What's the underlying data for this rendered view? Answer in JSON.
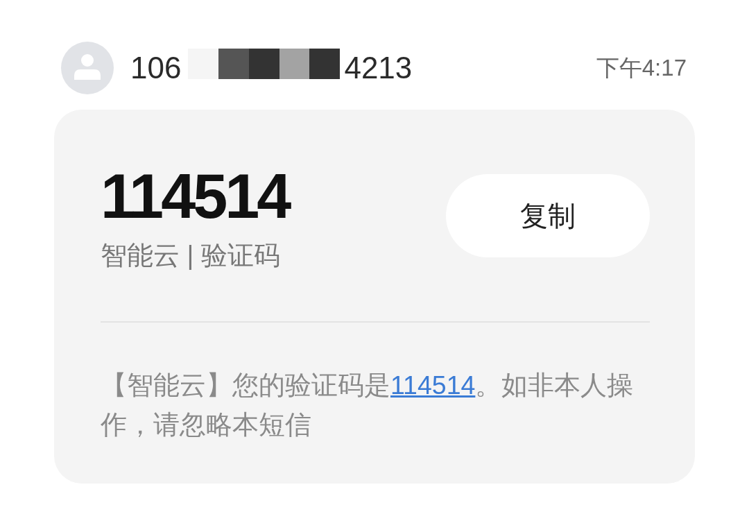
{
  "conversation": {
    "sender": {
      "number_start": "106",
      "number_end": "4213"
    },
    "time": "下午4:17"
  },
  "card": {
    "code": "114514",
    "subtitle": "智能云 | 验证码",
    "copy_button": "复制",
    "message": {
      "before": "【智能云】您的验证码是",
      "link": "114514",
      "after": "。如非本人操作，请忽略本短信"
    }
  }
}
